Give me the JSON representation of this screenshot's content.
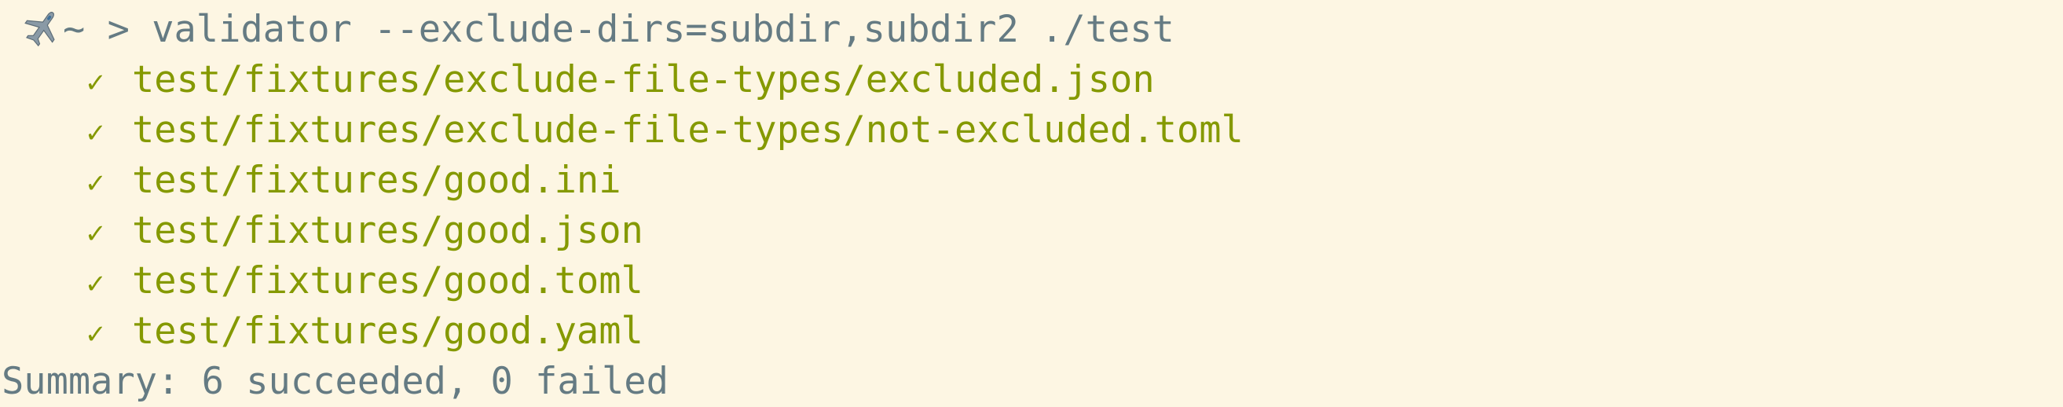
{
  "terminal": {
    "colors": {
      "background": "#fdf6e3",
      "text": "#657b83",
      "success": "#859900"
    },
    "prompt": {
      "icon": "airplane-icon",
      "symbol": "~ > ",
      "command": "validator --exclude-dirs=subdir,subdir2 ./test"
    },
    "results": [
      {
        "status": "✓",
        "path": "test/fixtures/exclude-file-types/excluded.json"
      },
      {
        "status": "✓",
        "path": "test/fixtures/exclude-file-types/not-excluded.toml"
      },
      {
        "status": "✓",
        "path": "test/fixtures/good.ini"
      },
      {
        "status": "✓",
        "path": "test/fixtures/good.json"
      },
      {
        "status": "✓",
        "path": "test/fixtures/good.toml"
      },
      {
        "status": "✓",
        "path": "test/fixtures/good.yaml"
      }
    ],
    "summary": "Summary: 6 succeeded, 0 failed"
  }
}
